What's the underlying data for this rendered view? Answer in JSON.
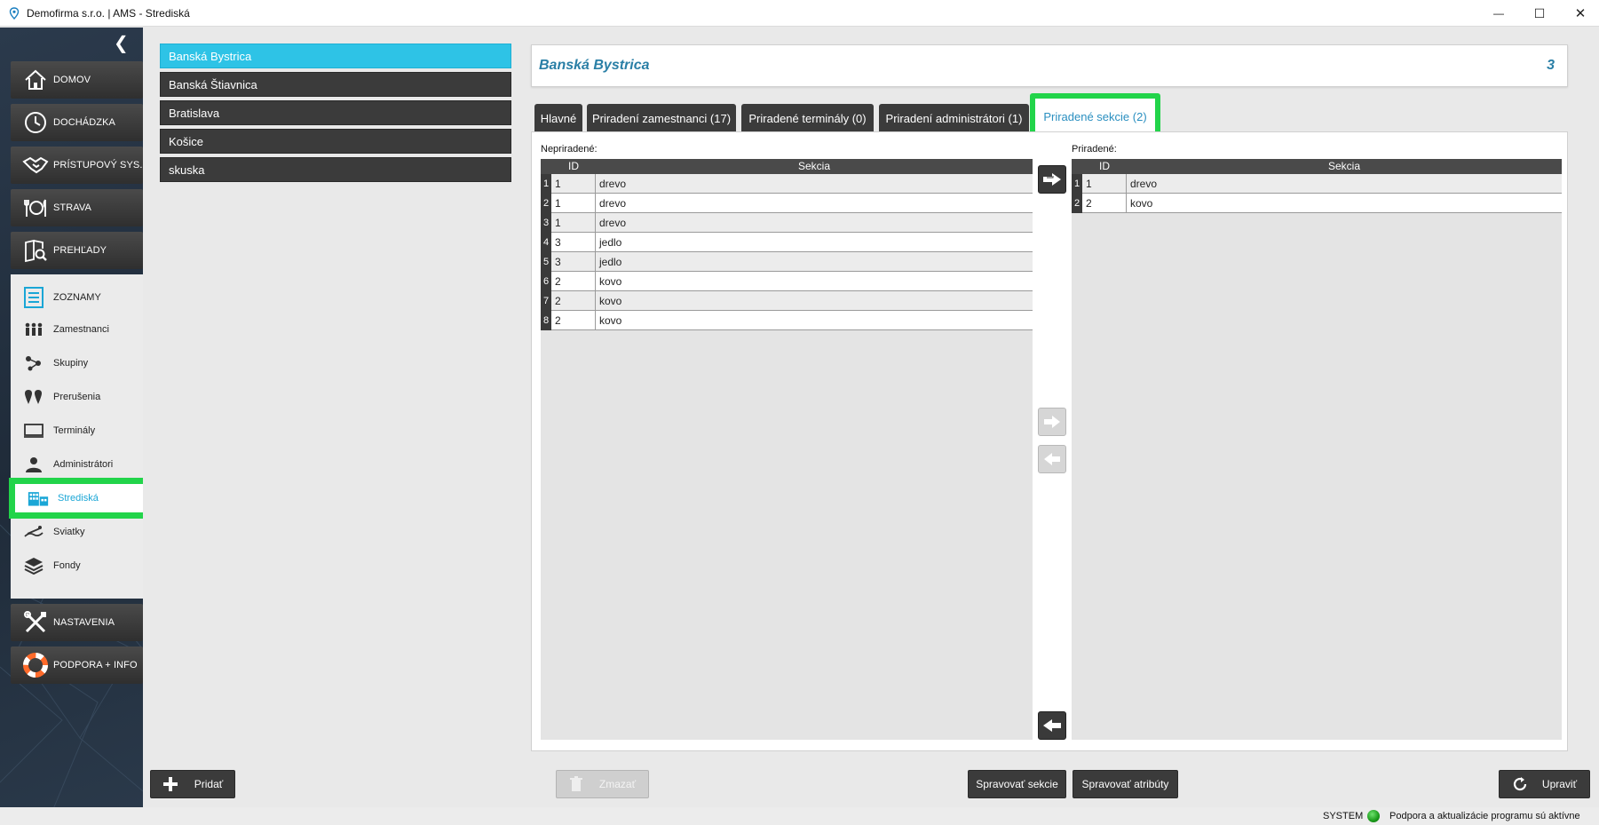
{
  "window": {
    "title": "Demofirma s.r.o. | AMS - Strediská",
    "minimize": "—",
    "maximize": "☐",
    "close": "✕"
  },
  "sidebar": {
    "collapse_glyph": "❮",
    "main_items": [
      {
        "label": "DOMOV",
        "icon": "home-icon"
      },
      {
        "label": "DOCHÁDZKA",
        "icon": "clock-icon"
      },
      {
        "label": "PRÍSTUPOVÝ SYS.",
        "icon": "handshake-icon"
      },
      {
        "label": "STRAVA",
        "icon": "cutlery-icon"
      },
      {
        "label": "PREHĽADY",
        "icon": "report-search-icon"
      }
    ],
    "sub_header": {
      "label": "ZOZNAMY",
      "icon": "list-icon"
    },
    "sub_items": [
      {
        "label": "Zamestnanci",
        "icon": "people-icon"
      },
      {
        "label": "Skupiny",
        "icon": "group-icon"
      },
      {
        "label": "Prerušenia",
        "icon": "pins-icon"
      },
      {
        "label": "Terminály",
        "icon": "terminal-icon"
      },
      {
        "label": "Administrátori",
        "icon": "admin-icon"
      },
      {
        "label": "Strediská",
        "icon": "building-icon"
      },
      {
        "label": "Sviatky",
        "icon": "holiday-icon"
      },
      {
        "label": "Fondy",
        "icon": "layers-icon"
      }
    ],
    "bottom_items": [
      {
        "label": "NASTAVENIA",
        "icon": "tools-icon"
      },
      {
        "label": "PODPORA + INFO",
        "icon": "lifebuoy-icon"
      }
    ],
    "accent": "#22d44a"
  },
  "cities": [
    "Banská Bystrica",
    "Banská Štiavnica",
    "Bratislava",
    "Košice",
    "skuska"
  ],
  "detail": {
    "name": "Banská Bystrica",
    "count": "3"
  },
  "tabs": [
    "Hlavné",
    "Priradení zamestnanci (17)",
    "Priradené terminály (0)",
    "Priradení administrátori (1)",
    "Priradené sekcie (2)"
  ],
  "unassigned": {
    "label": "Nepriradené:",
    "columns": [
      "ID",
      "Sekcia"
    ],
    "rows": [
      {
        "n": "1",
        "id": "1",
        "sekcia": "drevo"
      },
      {
        "n": "2",
        "id": "1",
        "sekcia": "drevo"
      },
      {
        "n": "3",
        "id": "1",
        "sekcia": "drevo"
      },
      {
        "n": "4",
        "id": "3",
        "sekcia": "jedlo"
      },
      {
        "n": "5",
        "id": "3",
        "sekcia": "jedlo"
      },
      {
        "n": "6",
        "id": "2",
        "sekcia": "kovo"
      },
      {
        "n": "7",
        "id": "2",
        "sekcia": "kovo"
      },
      {
        "n": "8",
        "id": "2",
        "sekcia": "kovo"
      }
    ]
  },
  "assigned": {
    "label": "Priradené:",
    "columns": [
      "ID",
      "Sekcia"
    ],
    "rows": [
      {
        "n": "1",
        "id": "1",
        "sekcia": "drevo"
      },
      {
        "n": "2",
        "id": "2",
        "sekcia": "kovo"
      }
    ]
  },
  "buttons": {
    "add": "Pridať",
    "delete": "Zmazať",
    "manage_sections": "Spravovať sekcie",
    "manage_attributes": "Spravovať atribúty",
    "edit": "Upraviť"
  },
  "status": {
    "user": "SYSTEM",
    "message": "Podpora a aktualizácie programu sú aktívne"
  }
}
